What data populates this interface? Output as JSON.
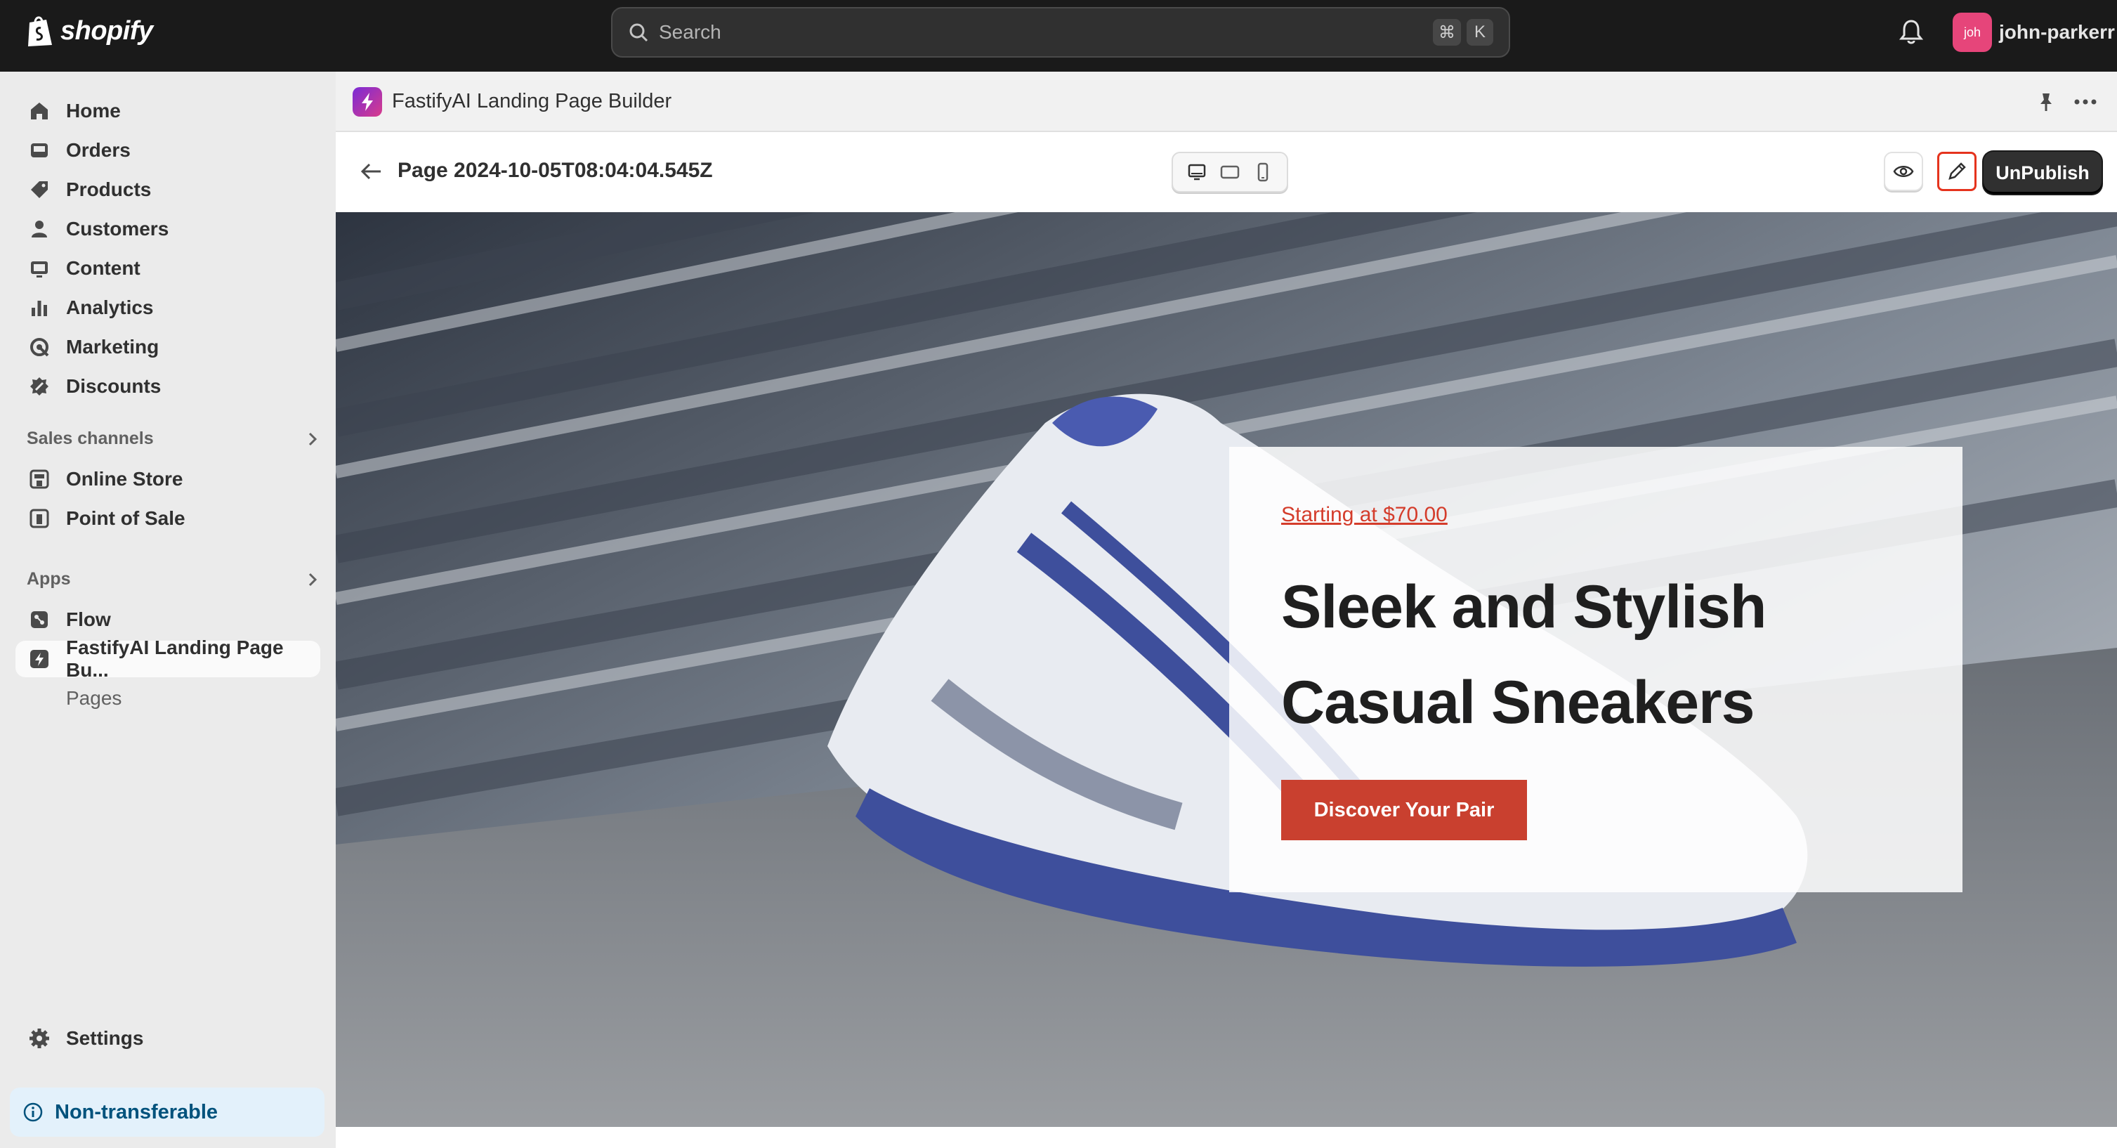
{
  "topbar": {
    "brand": "shopify",
    "search": {
      "placeholder": "Search",
      "shortcut_keys": [
        "⌘",
        "K"
      ]
    },
    "user": {
      "avatar_initials": "joh",
      "name": "john-parkerr",
      "avatar_color": "#e6457a"
    }
  },
  "sidebar": {
    "items": [
      {
        "label": "Home",
        "icon": "home-icon"
      },
      {
        "label": "Orders",
        "icon": "inbox-icon"
      },
      {
        "label": "Products",
        "icon": "tag-icon"
      },
      {
        "label": "Customers",
        "icon": "person-icon"
      },
      {
        "label": "Content",
        "icon": "image-icon"
      },
      {
        "label": "Analytics",
        "icon": "bar-chart-icon"
      },
      {
        "label": "Marketing",
        "icon": "target-icon"
      },
      {
        "label": "Discounts",
        "icon": "discount-icon"
      }
    ],
    "sales_channels": {
      "label": "Sales channels",
      "items": [
        {
          "label": "Online Store",
          "icon": "store-icon"
        },
        {
          "label": "Point of Sale",
          "icon": "pos-icon"
        }
      ]
    },
    "apps": {
      "label": "Apps",
      "items": [
        {
          "label": "Flow",
          "icon": "flow-icon"
        },
        {
          "label": "FastifyAI Landing Page Bu...",
          "icon": "fastify-icon",
          "active": true
        },
        {
          "label": "Pages",
          "sub": true
        }
      ]
    },
    "settings": {
      "label": "Settings",
      "icon": "gear-icon"
    },
    "notice": {
      "label": "Non-transferable",
      "icon": "info-icon"
    }
  },
  "app_header": {
    "title": "FastifyAI Landing Page Builder"
  },
  "page_bar": {
    "title": "Page 2024-10-05T08:04:04.545Z",
    "devices": [
      "desktop-icon",
      "tablet-icon",
      "mobile-icon"
    ],
    "unpublish_label": "UnPublish",
    "edit_highlight_color": "#e5331d"
  },
  "hero": {
    "price_link": "Starting at $70.00",
    "headline": "Sleek and Stylish Casual Sneakers",
    "cta_label": "Discover Your Pair",
    "accent_color": "#c9402f"
  }
}
